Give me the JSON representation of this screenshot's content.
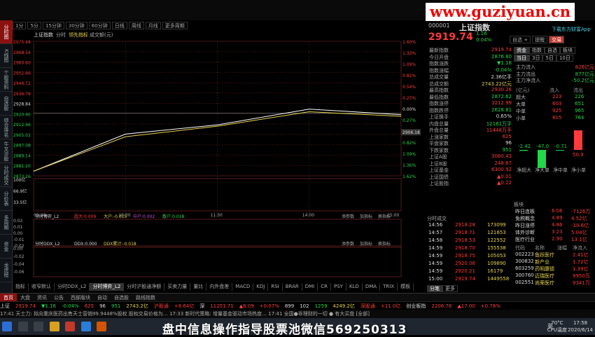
{
  "watermark": "www.guziyuan.cn",
  "overlay_text": "盘中信息操作指导股票池微信569250313",
  "left_tabs": [
    "分时图",
    "K线图",
    "个股资料",
    "自选股",
    "综合排名",
    "牛叉诊股",
    "分时成交",
    "分价表",
    "多周期",
    "资金",
    "龙虎榜"
  ],
  "toolbar": [
    "1分",
    "5分",
    "15分钟",
    "30分钟",
    "60分钟",
    "日线",
    "周线",
    "月线",
    "更多周期"
  ],
  "chart_header": {
    "index": "上证指数",
    "mode": "分时",
    "leading": "领先指标",
    "volume": "成交额(元)"
  },
  "price_axis": [
    "2975.48",
    "2968.54",
    "2960.60",
    "2952.66",
    "2944.72",
    "2936.78",
    "2928.84",
    "2920.90",
    "2912.96",
    "2905.02",
    "2897.08",
    "2889.14",
    "2881.20",
    "2873.26"
  ],
  "pct_axis": [
    "1.60%",
    "1.33%",
    "1.09%",
    "0.82%",
    "0.54%",
    "0.27%",
    "0.00%",
    "0.27%",
    "0.54%",
    "0.82%",
    "1.09%",
    "1.36%",
    "1.62%"
  ],
  "last_tag": "2906.18",
  "vol_axis": [
    "100亿",
    "66.9亿",
    "33.5亿"
  ],
  "time_axis": [
    "09:30",
    "10:30",
    "11:30",
    "14:00",
    "15:00"
  ],
  "sub1": {
    "title": "分时博弈_L2",
    "items": [
      "超大:0.009",
      "大户:-0.015",
      "中户:0.002",
      "散户:0.018"
    ],
    "btns": [
      "添参数",
      "加指标",
      "换指标"
    ],
    "axis": [
      "0.02",
      "0.01",
      "0.00",
      "-0.01",
      "-0.02"
    ]
  },
  "sub2": {
    "title": "分时DDX_L2",
    "items": [
      "DDX:0.000",
      "DDX累计:-0.018"
    ],
    "btns": [
      "添参数",
      "加指标",
      "换指标"
    ],
    "axis": [
      "0.00",
      "-0.02",
      "-0.04",
      "-0.06"
    ]
  },
  "bottom_tabs": [
    "指标",
    "收窄默认",
    "分时DDX_L2",
    "分时博弈_L2",
    "分时沪股通净额",
    "买卖力量",
    "量比",
    "内外盘差",
    "MACD",
    "KDJ",
    "RSI",
    "BRAR",
    "DMI",
    "CR",
    "PSY",
    "KLD",
    "DMA",
    "TRIX",
    "模板"
  ],
  "header": {
    "code": "000001",
    "name": "上证指数",
    "price": "2919.74",
    "chg": "1.16",
    "pct": "0.04%",
    "buttons": [
      "自选 +",
      "提醒",
      "交易"
    ],
    "link": "下载东方财富App"
  },
  "stats": [
    {
      "k": "最新指数",
      "v": "2919.74",
      "c": "red"
    },
    {
      "k": "今日开盘",
      "v": "2876.80",
      "c": "green"
    },
    {
      "k": "指数涨跌",
      "v": "▼1.16",
      "c": "green"
    },
    {
      "k": "指数涨幅",
      "v": "-0.04%",
      "c": "green"
    },
    {
      "k": "总成交量",
      "v": "2.36亿手",
      "c": "wh"
    },
    {
      "k": "总成交额",
      "v": "2743.22亿元",
      "c": "yel"
    },
    {
      "k": "最高指数",
      "v": "2930.26",
      "c": "red"
    },
    {
      "k": "最低指数",
      "v": "2872.62",
      "c": "green"
    },
    {
      "k": "指数涨停",
      "v": "3212.99",
      "c": "red"
    },
    {
      "k": "指数跌停",
      "v": "2628.81",
      "c": "green"
    },
    {
      "k": "上证换手",
      "v": "0.65%",
      "c": "wh"
    },
    {
      "k": "内盘总量",
      "v": "12161万手",
      "c": "green"
    },
    {
      "k": "外盘总量",
      "v": "11448万手",
      "c": "red"
    },
    {
      "k": "上涨家数",
      "v": "625",
      "c": "red"
    },
    {
      "k": "平盘家数",
      "v": "96",
      "c": "wh"
    },
    {
      "k": "下跌家数",
      "v": "951",
      "c": "green"
    },
    {
      "k": "上证A股",
      "v": "3060.43",
      "c": "red"
    },
    {
      "k": "上证B股",
      "v": "248.67",
      "c": "red"
    },
    {
      "k": "上证基金",
      "v": "6300.92",
      "c": "red"
    },
    {
      "k": "上证国债",
      "v": "▲0.01",
      "c": "red"
    },
    {
      "k": "上证股指",
      "v": "▲0.22",
      "c": "red"
    }
  ],
  "fund_tabs": [
    "资金",
    "指数",
    "自选",
    "板块"
  ],
  "fund_subtabs": [
    "当日",
    "3日",
    "5日",
    "10日"
  ],
  "fund_rows": [
    {
      "k": "主力流入",
      "v": "826亿元",
      "c": "red"
    },
    {
      "k": "主力流出",
      "v": "877亿元",
      "c": "green"
    },
    {
      "k": "主力净流入",
      "v": "-50.2亿元",
      "c": "green"
    }
  ],
  "fund_tbl_head": [
    "(亿元)",
    "流入",
    "流出"
  ],
  "fund_tbl": [
    [
      "超大",
      "223",
      "226"
    ],
    [
      "大单",
      "603",
      "651"
    ],
    [
      "中单",
      "925",
      "965"
    ],
    [
      "小单",
      "815",
      "764"
    ]
  ],
  "fund_bars": {
    "values": [
      -2.42,
      -47.0,
      -0.71,
      50.9
    ],
    "labels": [
      "净超大",
      "净大单",
      "净中单",
      "净小单"
    ]
  },
  "fund_bar_labels": [
    "-2.42",
    "-47.0",
    "-0.71",
    "50.9"
  ],
  "sectors_title": "板块",
  "sectors": [
    [
      "昨日连板",
      "6.06",
      "-7126万"
    ],
    [
      "免税概念",
      "4.89",
      "4.52亿"
    ],
    [
      "昨日涨停",
      "4.86",
      "-10.6亿"
    ],
    [
      "体外诊断",
      "3.23",
      "5.04亿"
    ],
    [
      "医疗行业",
      "2.90",
      "13.1亿"
    ]
  ],
  "stocks_head": [
    "代码",
    "名称",
    "涨幅",
    "净流入"
  ],
  "stocks": [
    [
      "002223",
      "鱼跃医疗",
      "",
      "2.41亿"
    ],
    [
      "300832",
      "新产业",
      "",
      "1.72亿"
    ],
    [
      "603259",
      "药明康德",
      "",
      "1.39亿"
    ],
    [
      "300760",
      "迈瑞医疗",
      "",
      "9950万"
    ],
    [
      "002551",
      "尚荣医疗",
      "",
      "9341万"
    ]
  ],
  "trades_title": "分时成交",
  "trades": [
    [
      "14:56",
      "2918.28",
      "173099"
    ],
    [
      "14:57",
      "2918.71",
      "121653"
    ],
    [
      "14:58",
      "2918.53",
      "122552"
    ],
    [
      "14:59",
      "2918.70",
      "155538"
    ],
    [
      "14:59",
      "2918.75",
      "105053"
    ],
    [
      "14:59",
      "2920.06",
      "109890"
    ],
    [
      "14:59",
      "2920.21",
      "16179"
    ],
    [
      "15:00",
      "2919.74",
      "1449558"
    ]
  ],
  "right_bottom_tabs": [
    "分笔",
    "更多"
  ],
  "nav_tabs": [
    "首页",
    "大盘",
    "资讯",
    "公告",
    "西部版块",
    "自动",
    "自选股",
    "路线指数"
  ],
  "ticker": [
    {
      "t": "上证",
      "c": "wh"
    },
    {
      "t": "2919.74",
      "c": "red"
    },
    {
      "t": "▼1.16",
      "c": "green"
    },
    {
      "t": "-0.04%",
      "c": "green"
    },
    {
      "t": "625",
      "c": "red"
    },
    {
      "t": "96",
      "c": "wh"
    },
    {
      "t": "951",
      "c": "green"
    },
    {
      "t": "2743.2亿",
      "c": "yel"
    },
    {
      "t": "沪股通",
      "c": "red"
    },
    {
      "t": "+8.64亿",
      "c": "red"
    },
    {
      "t": "深",
      "c": "wh"
    },
    {
      "t": "11251.71",
      "c": "red"
    },
    {
      "t": "▲8.09",
      "c": "red"
    },
    {
      "t": "+0.07%",
      "c": "red"
    },
    {
      "t": "899",
      "c": "wh"
    },
    {
      "t": "102",
      "c": "wh"
    },
    {
      "t": "1259",
      "c": "green"
    },
    {
      "t": "4249.2亿",
      "c": "yel"
    },
    {
      "t": "深股通",
      "c": "red"
    },
    {
      "t": "+11.0亿",
      "c": "red"
    },
    {
      "t": "创业板指",
      "c": "wh"
    },
    {
      "t": "2206.76",
      "c": "red"
    },
    {
      "t": "▲17.00",
      "c": "red"
    },
    {
      "t": "+0.78%",
      "c": "red"
    }
  ],
  "status": "17:41 天士力: 拟向重庆医药出售天士营销99.9448%股权 股权交易价格为… 17:33 新时代策略: 增量基金驱动市场热度… 17:41 全国●非理财的一切 ● 有大买盘 [全部]",
  "taskbar": {
    "time": "17:58",
    "date": "2020/6/14",
    "temp": "70°C",
    "cpu": "CPU温度",
    "lang": "英"
  },
  "chart_data": [
    {
      "type": "line",
      "title": "上证指数 分时",
      "x": [
        "09:30",
        "10:30",
        "11:30",
        "14:00",
        "15:00"
      ],
      "series": [
        {
          "name": "上证指数",
          "values": [
            2876.8,
            2905,
            2912,
            2924,
            2919.74
          ]
        },
        {
          "name": "领先指标",
          "values": [
            2876.8,
            2903,
            2911,
            2922,
            2918.5
          ]
        }
      ],
      "ylim": [
        2873.26,
        2975.48
      ],
      "prev_close": 2920.9
    }
  ]
}
